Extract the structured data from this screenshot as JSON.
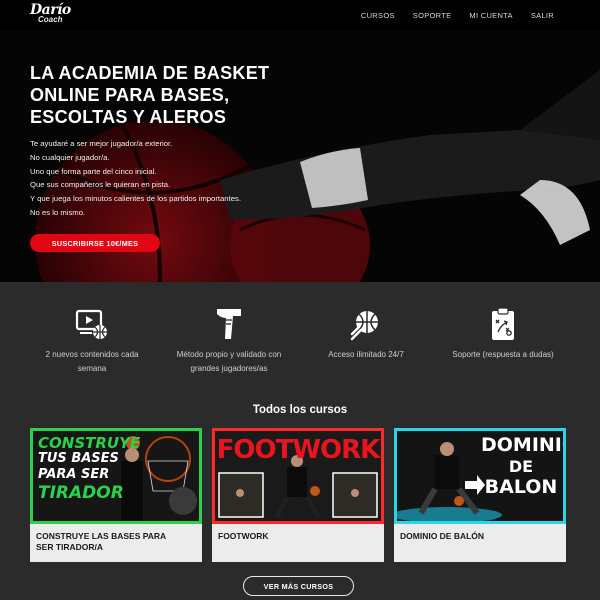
{
  "nav": {
    "logo_line1": "Darío",
    "logo_line2": "Coach",
    "items": [
      "CURSOS",
      "SOPORTE",
      "MI CUENTA",
      "SALIR"
    ]
  },
  "hero": {
    "title_lines": [
      "LA ACADEMIA DE BASKET",
      "ONLINE PARA BASES,",
      "ESCOLTAS Y ALEROS"
    ],
    "lines": [
      "Te ayudaré a ser mejor jugador/a exterior.",
      "No cualquier jugador/a.",
      "Uno que forma parte del cinco inicial.",
      "Que sus compañeros le quieran en pista.",
      "Y que juega los minutos calientes de los partidos importantes.",
      "No es lo mismo."
    ],
    "cta_label": "SUSCRIBIRSE 10€/MES"
  },
  "features": [
    {
      "icon": "video-basketball-icon",
      "label_lines": [
        "2 nuevos contenidos cada",
        "semana"
      ]
    },
    {
      "icon": "shoe-icon",
      "label_lines": [
        "Método propio y validado con",
        "grandes jugadores/as"
      ]
    },
    {
      "icon": "basketball-arrows-icon",
      "label_lines": [
        "Acceso ilimitado 24/7"
      ]
    },
    {
      "icon": "clipboard-play-icon",
      "label_lines": [
        "Soporte (respuesta a dudas)"
      ]
    }
  ],
  "courses_title": "Todos los cursos",
  "courses": [
    {
      "title_lines": [
        "CONSTRUYE LAS BASES PARA",
        "SER TIRADOR/A"
      ],
      "thumb_lines": [
        "CONSTRUYE",
        "TUS BASES",
        "PARA SER",
        "TIRADOR"
      ],
      "border": "#2bd14a"
    },
    {
      "title_lines": [
        "FOOTWORK"
      ],
      "thumb_lines": [
        "FOOTWORK"
      ],
      "border": "#ff2a2a"
    },
    {
      "title_lines": [
        "DOMINIO DE BALÓN"
      ],
      "thumb_lines": [
        "DOMINIO",
        "DE",
        "BALON"
      ],
      "border": "#27d6e8"
    }
  ],
  "more_label": "VER MÁS CURSOS",
  "colors": {
    "accent": "#e10614",
    "bg_dark": "#2b2b2b",
    "card_bg": "#ececec"
  }
}
